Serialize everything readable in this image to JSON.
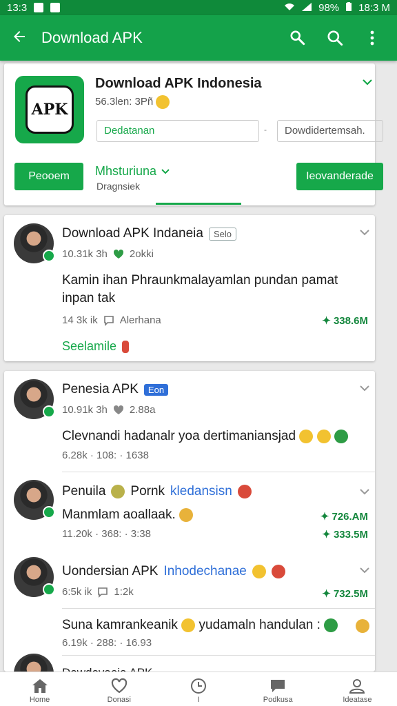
{
  "status_bar": {
    "time": "13:3",
    "battery": "98%",
    "clock": "18:3 M"
  },
  "app_bar": {
    "title": "Download APK"
  },
  "header": {
    "app_name": "Download APK Indonesia",
    "meta": "56.3len: 3Pñ",
    "icon_text": "APK",
    "field_value": "Dedatanan",
    "field_separator": "-",
    "search_placeholder": "Dowdidertemsah.",
    "left_button": "Peooem",
    "dropdown_label": "Mhsturiuna",
    "dropdown_sub": "Dragnsiek",
    "right_button": "Ieovanderade"
  },
  "post1": {
    "title": "Download APK Indaneia",
    "tag": "Selo",
    "meta": "10.31k 3h",
    "meta_extra": "2okki",
    "body": "Kamin ihan Phraunkmalayamlan pundan pamat inpan tak",
    "stats": "14 3k  ik",
    "stats_extra": "Alerhana",
    "stat_right": "✦ 338.6M",
    "footer_link": "Seelamile"
  },
  "post2": {
    "title": "Penesia APK",
    "tag": "Eon",
    "meta": "10.91k 3h",
    "meta_extra": "2.88a",
    "body": "Clevnandi hadanalr yoa dertimaniansjad",
    "stats": "6.28k · 108: · 1638"
  },
  "comments": [
    {
      "name": "Penuila",
      "name2": "Pornk",
      "link": "kledansisn",
      "text": "Manmlam aoallaak.",
      "stats": "11.20k · 368: · 3:38",
      "stat_a": "✦ 726.AM",
      "stat_b": "✦ 333.5M"
    },
    {
      "name": "Uondersian APK",
      "link": "Inhodechanae",
      "stats": "6:5k  ik",
      "stats_extra": "1:2k",
      "stat_a": "✦ 732.5M"
    }
  ],
  "comment3": {
    "text": "Suna kamrankeanik",
    "text2": "yudamaln handulan :",
    "stats": "6.19k · 288: · 16.93"
  },
  "partial_title": "Dowdovaeia APK",
  "bottom_nav": [
    {
      "label": "Home"
    },
    {
      "label": "Donasi"
    },
    {
      "label": "I"
    },
    {
      "label": "Podkusa"
    },
    {
      "label": "Ideatase"
    }
  ],
  "colors": {
    "primary": "#16a84a",
    "status": "#0f8a3a",
    "accent_blue": "#2f6fd8"
  }
}
